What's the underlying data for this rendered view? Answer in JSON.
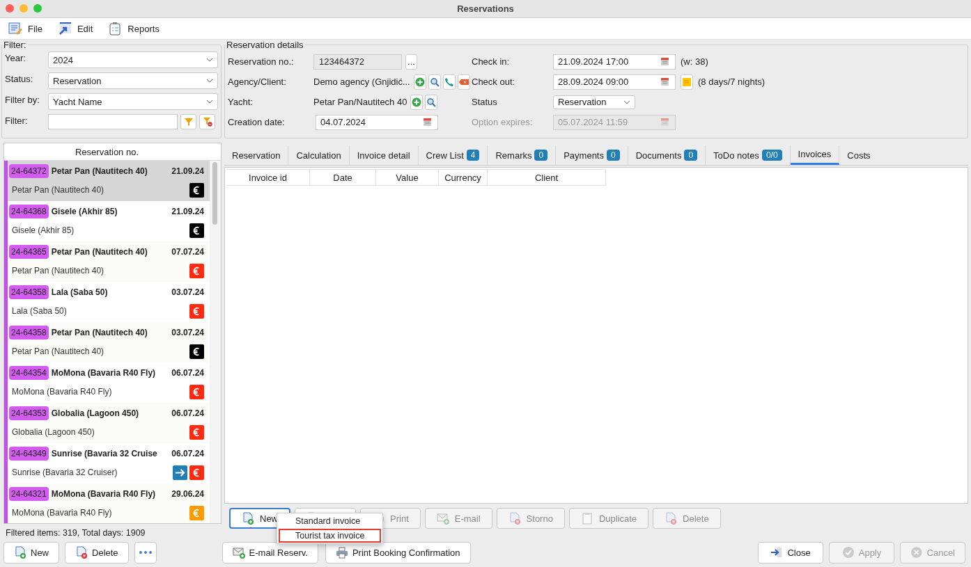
{
  "window": {
    "title": "Reservations"
  },
  "menu": [
    {
      "label": "File",
      "kind": "file"
    },
    {
      "label": "Edit",
      "kind": "edit"
    },
    {
      "label": "Reports",
      "kind": "reports"
    }
  ],
  "filter": {
    "legend": "Filter:",
    "fields": [
      {
        "label": "Year:",
        "kind": "select",
        "value": "2024"
      },
      {
        "label": "Status:",
        "kind": "select",
        "value": "Reservation"
      },
      {
        "label": "Filter by:",
        "kind": "select",
        "value": "Yacht Name"
      },
      {
        "label": "Filter:",
        "kind": "text"
      }
    ]
  },
  "list": {
    "column": "Reservation no.",
    "rows": [
      {
        "code": "24-64372",
        "title": "Petar Pan (Nautitech 40)",
        "date": "21.09.24",
        "subtitle": "Petar Pan (Nautitech 40)",
        "color": "#000000",
        "transfer": false,
        "selected": true
      },
      {
        "code": "24-64368",
        "title": "Gisele (Akhir 85)",
        "date": "21.09.24",
        "subtitle": "Gisele (Akhir 85)",
        "color": "#000000",
        "transfer": false,
        "selected": false
      },
      {
        "code": "24-64365",
        "title": "Petar Pan (Nautitech 40)",
        "date": "07.07.24",
        "subtitle": "Petar Pan (Nautitech 40)",
        "color": "#ff2a10",
        "transfer": false,
        "selected": false
      },
      {
        "code": "24-64358",
        "title": "Lala (Saba 50)",
        "date": "03.07.24",
        "subtitle": "Lala (Saba 50)",
        "color": "#ff2a10",
        "transfer": false,
        "selected": false
      },
      {
        "code": "24-64358",
        "title": "Petar Pan (Nautitech 40)",
        "date": "03.07.24",
        "subtitle": "Petar Pan (Nautitech 40)",
        "color": "#000000",
        "transfer": false,
        "selected": false
      },
      {
        "code": "24-64354",
        "title": "MoMona (Bavaria R40 Fly)",
        "date": "06.07.24",
        "subtitle": "MoMona (Bavaria R40 Fly)",
        "color": "#ff2a10",
        "transfer": false,
        "selected": false
      },
      {
        "code": "24-64353",
        "title": "Globalia (Lagoon 450)",
        "date": "06.07.24",
        "subtitle": "Globalia (Lagoon 450)",
        "color": "#ff2a10",
        "transfer": false,
        "selected": false
      },
      {
        "code": "24-64349",
        "title": "Sunrise (Bavaria 32 Cruise",
        "date": "06.07.24",
        "subtitle": "Sunrise (Bavaria 32 Cruiser)",
        "color": "#ff2a10",
        "transfer": true,
        "selected": false
      },
      {
        "code": "24-64321",
        "title": "MoMona (Bavaria R40 Fly)",
        "date": "29.06.24",
        "subtitle": "MoMona (Bavaria R40 Fly)",
        "color": "#ff9a00",
        "transfer": false,
        "selected": false
      }
    ],
    "status": "Filtered items: 319,  Total days: 1909"
  },
  "details": {
    "legend": "Reservation details",
    "reservation_no": {
      "label": "Reservation no.:",
      "value": "123464372",
      "button": "..."
    },
    "agency": {
      "label": "Agency/Client:",
      "value": "Demo agency (Gnjidić..."
    },
    "yacht": {
      "label": "Yacht:",
      "value": "Petar Pan/Nautitech 40"
    },
    "creation_date": {
      "label": "Creation date:",
      "value": "04.07.2024"
    },
    "check_in": {
      "label": "Check in:",
      "value": "21.09.2024 17:00",
      "note": "(w: 38)"
    },
    "check_out": {
      "label": "Check out:",
      "value": "28.09.2024 09:00",
      "note": "(8 days/7 nights)"
    },
    "status": {
      "label": "Status",
      "value": "Reservation"
    },
    "option_expires": {
      "label": "Option expires:",
      "value": "05.07.2024 11:59",
      "disabled": true
    }
  },
  "tabs": [
    {
      "label": "Reservation",
      "selected": false
    },
    {
      "label": "Calculation",
      "selected": false
    },
    {
      "label": "Invoice detail",
      "selected": false
    },
    {
      "label": "Crew List",
      "badge": "4",
      "selected": false
    },
    {
      "label": "Remarks",
      "badge": "0",
      "selected": false
    },
    {
      "label": "Payments",
      "badge": "0",
      "selected": false
    },
    {
      "label": "Documents",
      "badge": "0",
      "selected": false
    },
    {
      "label": "ToDo notes",
      "badge": "0/0",
      "selected": false
    },
    {
      "label": "Invoices",
      "selected": true
    },
    {
      "label": "Costs",
      "selected": false
    }
  ],
  "invoices": {
    "columns": [
      "Invoice id",
      "Date",
      "Value",
      "Currency",
      "Client"
    ]
  },
  "invoice_buttons": [
    {
      "label": "New",
      "kind": "new",
      "disabled": false
    },
    {
      "kind": "edit"
    },
    {
      "label": "Print",
      "kind": "print",
      "disabled": true
    },
    {
      "label": "E-mail",
      "kind": "mail",
      "disabled": true
    },
    {
      "label": "Storno",
      "kind": "storno",
      "disabled": true
    },
    {
      "label": "Duplicate",
      "kind": "duplicate",
      "disabled": true
    },
    {
      "label": "Delete",
      "kind": "delete",
      "disabled": true
    }
  ],
  "new_menu": [
    {
      "label": "Standard invoice",
      "selected": false
    },
    {
      "label": "Tourist tax invoice",
      "selected": true
    }
  ],
  "bottom_left": [
    {
      "label": "New",
      "kind": "new"
    },
    {
      "label": "Delete",
      "kind": "delete"
    },
    {
      "kind": "more"
    }
  ],
  "bottom_middle": [
    {
      "label": "E-mail Reserv.",
      "kind": "mail"
    },
    {
      "label": "Print Booking Confirmation",
      "kind": "print"
    }
  ],
  "bottom_right": [
    {
      "label": "Close",
      "kind": "close",
      "disabled": false
    },
    {
      "label": "Apply",
      "kind": "apply",
      "disabled": true
    },
    {
      "label": "Cancel",
      "kind": "cancel",
      "disabled": true
    }
  ]
}
